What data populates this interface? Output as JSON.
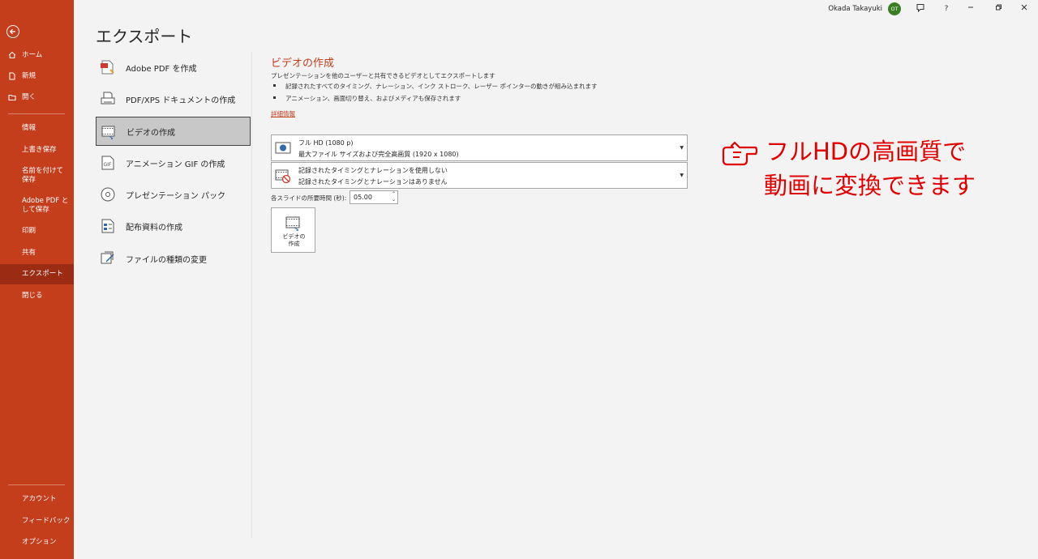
{
  "sidebar": {
    "items": [
      {
        "label": "ホーム"
      },
      {
        "label": "新規"
      },
      {
        "label": "開く"
      },
      {
        "label": "情報"
      },
      {
        "label": "上書き保存"
      },
      {
        "label": "名前を付けて保存"
      },
      {
        "label": "Adobe PDF として保存"
      },
      {
        "label": "印刷"
      },
      {
        "label": "共有"
      },
      {
        "label": "エクスポート"
      },
      {
        "label": "閉じる"
      }
    ],
    "bottom_items": [
      {
        "label": "アカウント"
      },
      {
        "label": "フィードバック"
      },
      {
        "label": "オプション"
      }
    ],
    "accent": "#c43e1c"
  },
  "titlebar": {
    "user_name": "Okada Takayuki",
    "avatar_initials": "OT"
  },
  "page_title": "エクスポート",
  "export_options": [
    {
      "label": "Adobe PDF を作成"
    },
    {
      "label": "PDF/XPS ドキュメントの作成"
    },
    {
      "label": "ビデオの作成"
    },
    {
      "label": "アニメーション GIF の作成"
    },
    {
      "label": "プレゼンテーション パック"
    },
    {
      "label": "配布資料の作成"
    },
    {
      "label": "ファイルの種類の変更"
    }
  ],
  "detail": {
    "title": "ビデオの作成",
    "description": "プレゼンテーションを他のユーザーと共有できるビデオとしてエクスポートします",
    "bullets": [
      "記録されたすべてのタイミング、ナレーション、インク ストローク、レーザー ポインターの動きが組み込まれます",
      "アニメーション、画面切り替え、およびメディアも保存されます"
    ],
    "link": "詳細情報",
    "quality_dropdown": {
      "line1": "フル HD (1080 p)",
      "line2": "最大ファイル サイズおよび完全高画質 (1920 x 1080)"
    },
    "timing_dropdown": {
      "line1": "記録されたタイミングとナレーションを使用しない",
      "line2": "記録されたタイミングとナレーションはありません"
    },
    "duration_label": "各スライドの所要時間 (秒):",
    "duration_value": "05.00",
    "create_button": {
      "line1": "ビデオの",
      "line2": "作成"
    }
  },
  "annotation": {
    "line1": "フルHDの高画質で",
    "line2": "動画に変換できます",
    "color": "#e00000"
  }
}
